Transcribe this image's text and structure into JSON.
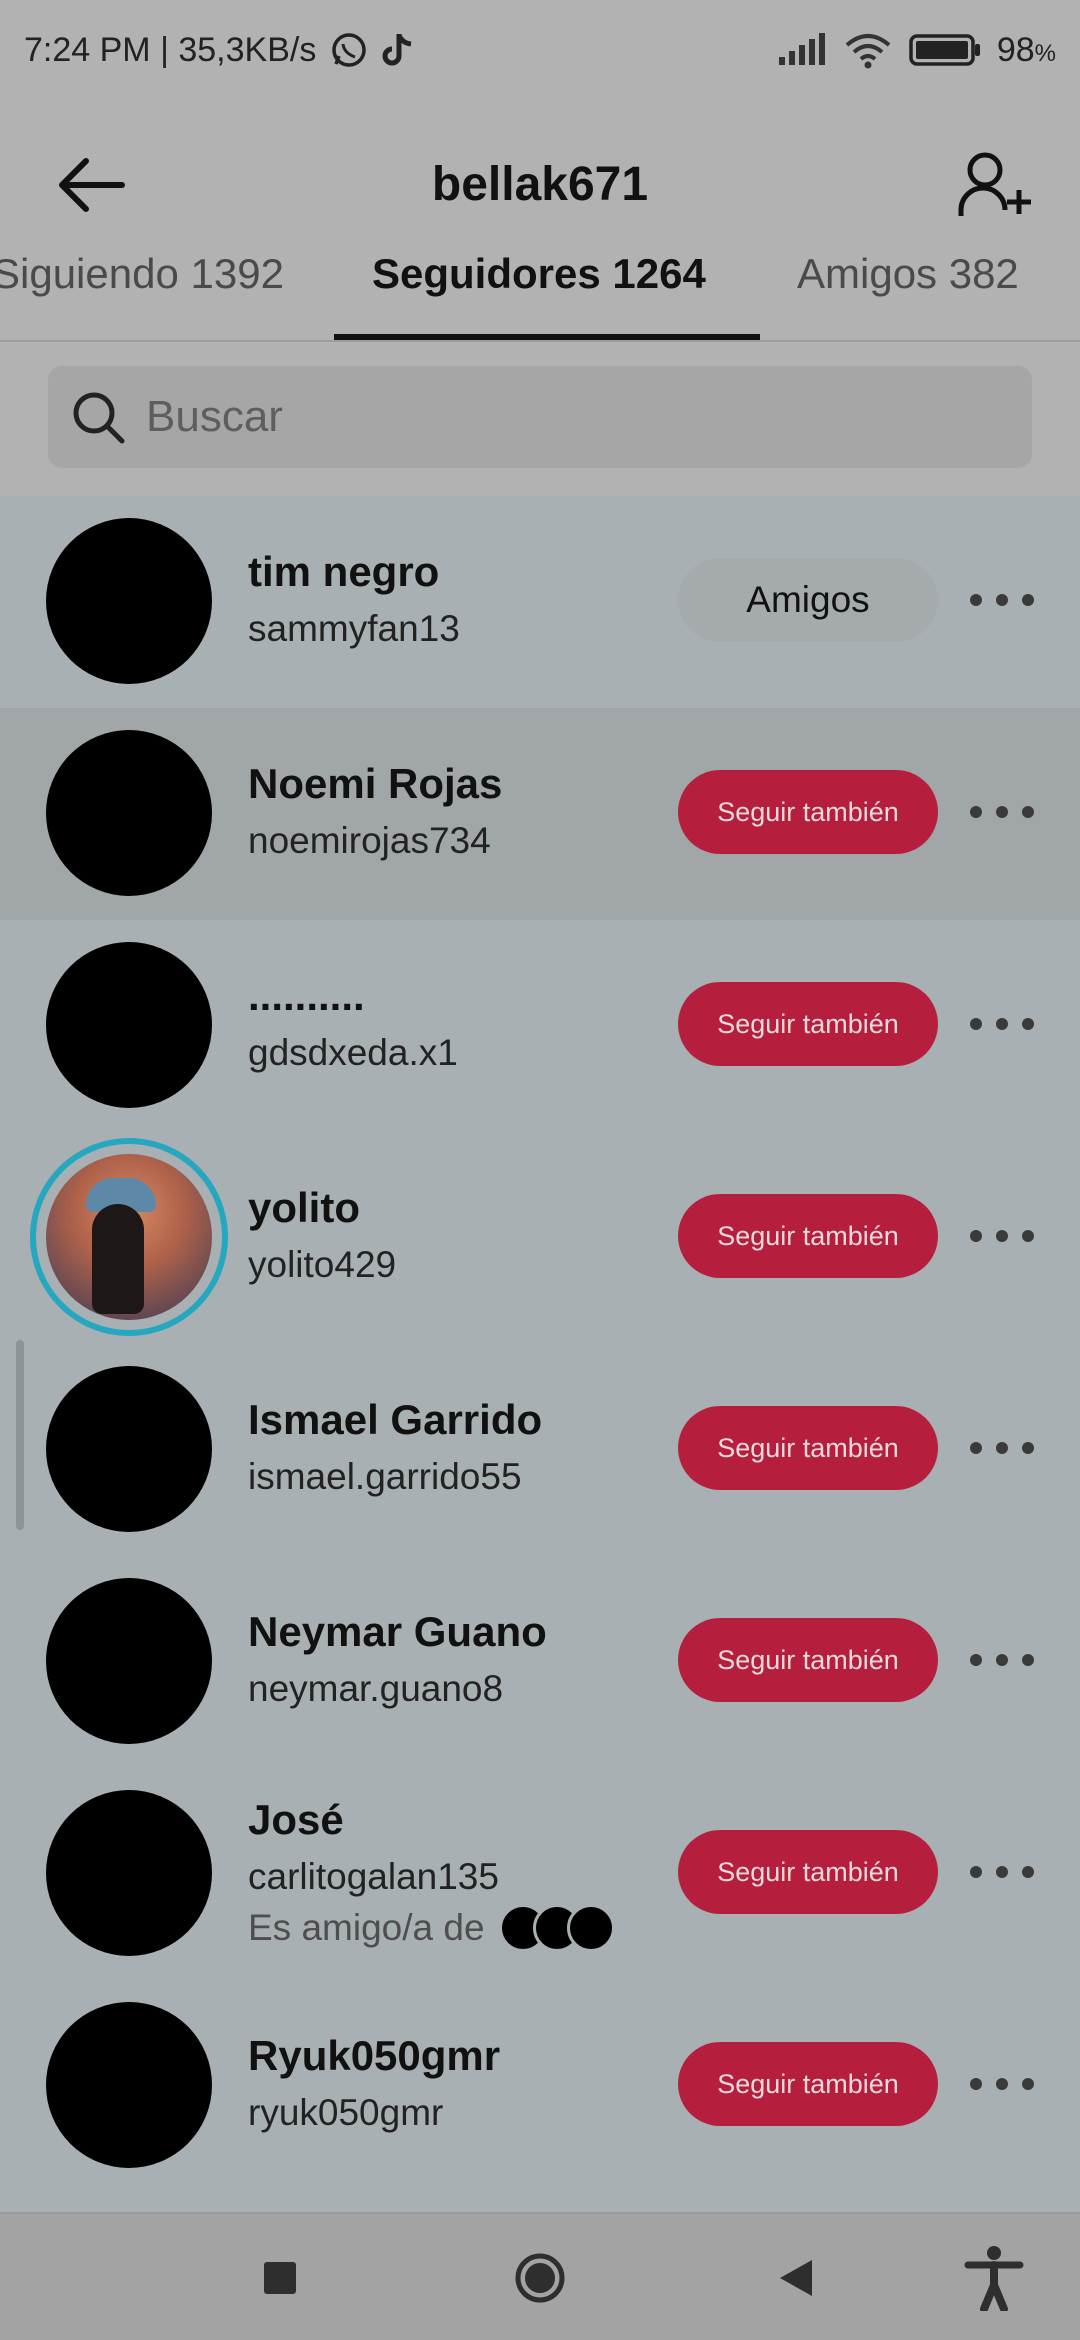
{
  "status_bar": {
    "time_speed": "7:24 PM | 35,3KB/s",
    "battery": "98",
    "battery_unit": "%",
    "icons": [
      "whatsapp-icon",
      "tiktok-icon",
      "signal-icon",
      "wifi-icon",
      "battery-icon"
    ]
  },
  "header": {
    "title": "bellak671",
    "back_icon": "arrow-left-icon",
    "add_icon": "add-user-icon"
  },
  "tabs": [
    {
      "label": "Siguiendo 1392"
    },
    {
      "label": "Seguidores 1264"
    },
    {
      "label": "Amigos 382"
    }
  ],
  "search": {
    "placeholder": "Buscar"
  },
  "followers": [
    {
      "name": "tim negro",
      "handle": "sammyfan13",
      "action": "Amigos"
    },
    {
      "name": "Noemi Rojas",
      "handle": "noemirojas734",
      "action": "Seguir también"
    },
    {
      "name": "..........",
      "handle": "gdsdxeda.x1",
      "action": "Seguir también"
    },
    {
      "name": "yolito",
      "handle": "yolito429",
      "action": "Seguir también"
    },
    {
      "name": "Ismael Garrido",
      "handle": "ismael.garrido55",
      "action": "Seguir también"
    },
    {
      "name": "Neymar Guano",
      "handle": "neymar.guano8",
      "action": "Seguir también"
    },
    {
      "name": "José",
      "handle": "carlitogalan135",
      "action": "Seguir también",
      "mutual": "Es amigo/a de"
    },
    {
      "name": "Ryuk050gmr",
      "handle": "ryuk050gmr",
      "action": "Seguir también"
    }
  ],
  "colors": {
    "follow_button": "#b51f3d",
    "accent_ring": "#24a7bf"
  }
}
